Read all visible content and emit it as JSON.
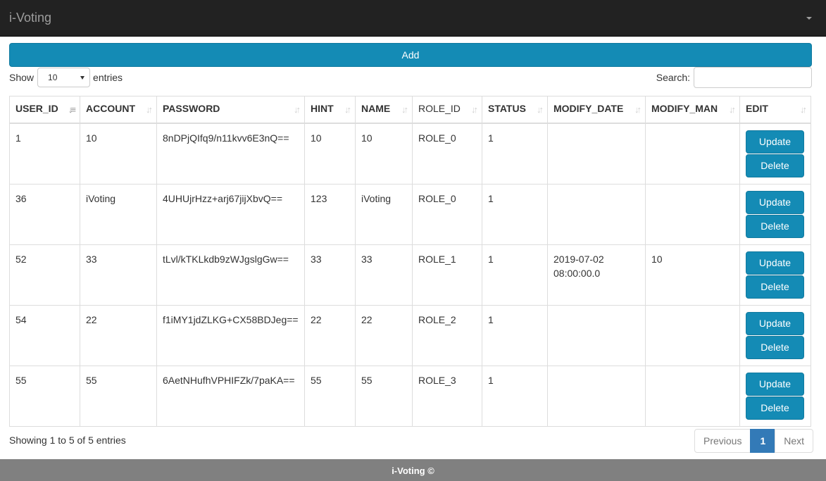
{
  "navbar": {
    "brand": "i-Voting"
  },
  "toolbar": {
    "add_label": "Add"
  },
  "length": {
    "prefix": "Show",
    "value": "10",
    "suffix": "entries"
  },
  "search": {
    "label": "Search:",
    "value": "",
    "placeholder": ""
  },
  "table": {
    "columns": [
      "USER_ID",
      "ACCOUNT",
      "PASSWORD",
      "HINT",
      "NAME",
      "ROLE_ID",
      "STATUS",
      "MODIFY_DATE",
      "MODIFY_MAN",
      "EDIT"
    ],
    "sorted_column": "USER_ID",
    "rows": [
      [
        "1",
        "10",
        "8nDPjQIfq9/n11kvv6E3nQ==",
        "10",
        "10",
        "ROLE_0",
        "1",
        "",
        ""
      ],
      [
        "36",
        "iVoting",
        "4UHUjrHzz+arj67jijXbvQ==",
        "123",
        "iVoting",
        "ROLE_0",
        "1",
        "",
        ""
      ],
      [
        "52",
        "33",
        "tLvl/kTKLkdb9zWJgslgGw==",
        "33",
        "33",
        "ROLE_1",
        "1",
        "2019-07-02 08:00:00.0",
        "10"
      ],
      [
        "54",
        "22",
        "f1iMY1jdZLKG+CX58BDJeg==",
        "22",
        "22",
        "ROLE_2",
        "1",
        "",
        ""
      ],
      [
        "55",
        "55",
        "6AetNHufhVPHIFZk/7paKA==",
        "55",
        "55",
        "ROLE_3",
        "1",
        "",
        ""
      ]
    ],
    "update_label": "Update",
    "delete_label": "Delete"
  },
  "info": "Showing 1 to 5 of 5 entries",
  "pagination": {
    "previous": "Previous",
    "current": "1",
    "next": "Next"
  },
  "footer": {
    "text": "i-Voting ©"
  },
  "colors": {
    "navbar": "#222222",
    "primary_button": "#148bb5",
    "active_page": "#337ab7",
    "footer": "#808080"
  }
}
